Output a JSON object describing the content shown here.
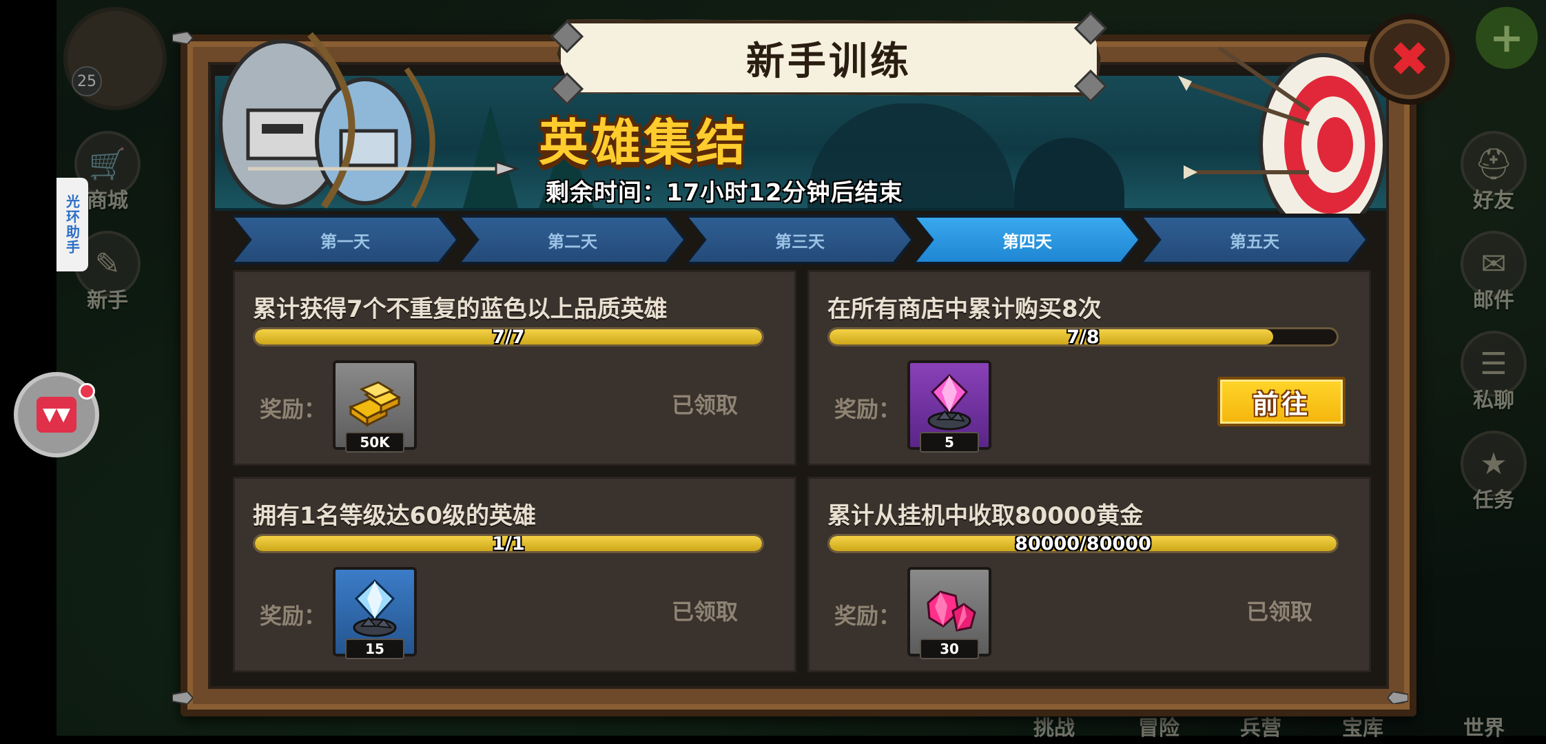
{
  "dialog": {
    "title": "新手训练",
    "banner_title": "英雄集结",
    "timer_text": "剩余时间：17小时12分钟后结束",
    "close_symbol": "✖"
  },
  "tabs": [
    {
      "label": "第一天",
      "active": false
    },
    {
      "label": "第二天",
      "active": false
    },
    {
      "label": "第三天",
      "active": false
    },
    {
      "label": "第四天",
      "active": true
    },
    {
      "label": "第五天",
      "active": false
    }
  ],
  "tasks": [
    {
      "title": "累计获得7个不重复的蓝色以上品质英雄",
      "progress_text": "7/7",
      "progress": 1.0,
      "reward_label": "奖励：",
      "reward_item": "gold-bars-icon",
      "reward_amount": "50K",
      "status": "已领取"
    },
    {
      "title": "在所有商店中累计购买8次",
      "progress_text": "7/8",
      "progress": 0.875,
      "reward_label": "奖励：",
      "reward_item": "purple-gem-icon",
      "reward_amount": "5",
      "action": "前往"
    },
    {
      "title": "拥有1名等级达60级的英雄",
      "progress_text": "1/1",
      "progress": 1.0,
      "reward_label": "奖励：",
      "reward_item": "blue-crystal-icon",
      "reward_amount": "15",
      "status": "已领取"
    },
    {
      "title": "累计从挂机中收取80000黄金",
      "progress_text": "80000/80000",
      "progress": 1.0,
      "reward_label": "奖励：",
      "reward_item": "pink-gems-icon",
      "reward_amount": "30",
      "status": "已领取"
    }
  ],
  "background": {
    "player_level": "25",
    "assist_tab": "光环助手",
    "left_menu": [
      "商城",
      "新手"
    ],
    "right_menu": [
      "好友",
      "邮件",
      "私聊",
      "任务"
    ],
    "bottom_nav": [
      "挑战",
      "冒险",
      "兵营",
      "宝库",
      "世界"
    ],
    "plus_symbol": "+"
  },
  "colors": {
    "accent_gold": "#ffcc2e",
    "tab_active": "#1f86d3",
    "progress_fill": "#f3d246",
    "close_red": "#e3262f"
  }
}
